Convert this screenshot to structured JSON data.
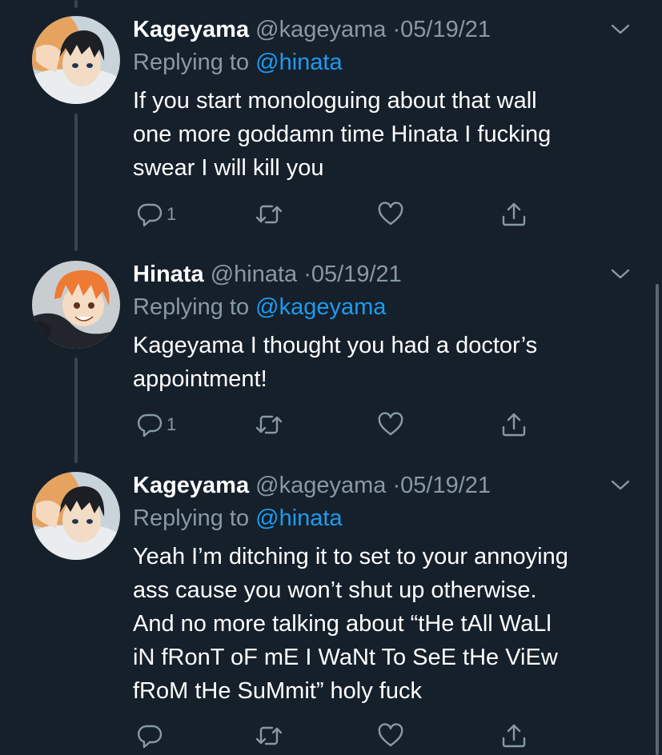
{
  "tweets": [
    {
      "name": "Kageyama",
      "handle": "@kageyama",
      "separator": "·",
      "date": "05/19/21",
      "replying_prefix": "Replying to ",
      "replying_to": "@hinata",
      "lines": [
        "If you start monologuing about that wall",
        "one more goddamn time Hinata I fucking",
        "swear I will kill you"
      ],
      "reply_count": "1"
    },
    {
      "name": "Hinata",
      "handle": "@hinata",
      "separator": "·",
      "date": "05/19/21",
      "replying_prefix": "Replying to ",
      "replying_to": "@kageyama",
      "lines": [
        "Kageyama I thought you had a doctor’s",
        "appointment!"
      ],
      "reply_count": "1"
    },
    {
      "name": "Kageyama",
      "handle": "@kageyama",
      "separator": "·",
      "date": "05/19/21",
      "replying_prefix": "Replying to ",
      "replying_to": "@hinata",
      "lines": [
        "Yeah I’m ditching it to set to your annoying",
        "ass cause you won’t shut up otherwise.",
        "And no more talking about “tHe tAll WaLl",
        "iN fRonT oF mE I WaNt To SeE tHe ViEw",
        "fRoM tHe SuMmit” holy fuck"
      ],
      "reply_count": ""
    }
  ],
  "icons": {
    "reply": "reply-icon",
    "retweet": "retweet-icon",
    "like": "heart-icon",
    "share": "share-icon",
    "more": "chevron-down-icon"
  },
  "colors": {
    "background": "#15202b",
    "secondary_text": "#8899a6",
    "mention": "#1d9bf0",
    "thread_line": "#38444d"
  }
}
